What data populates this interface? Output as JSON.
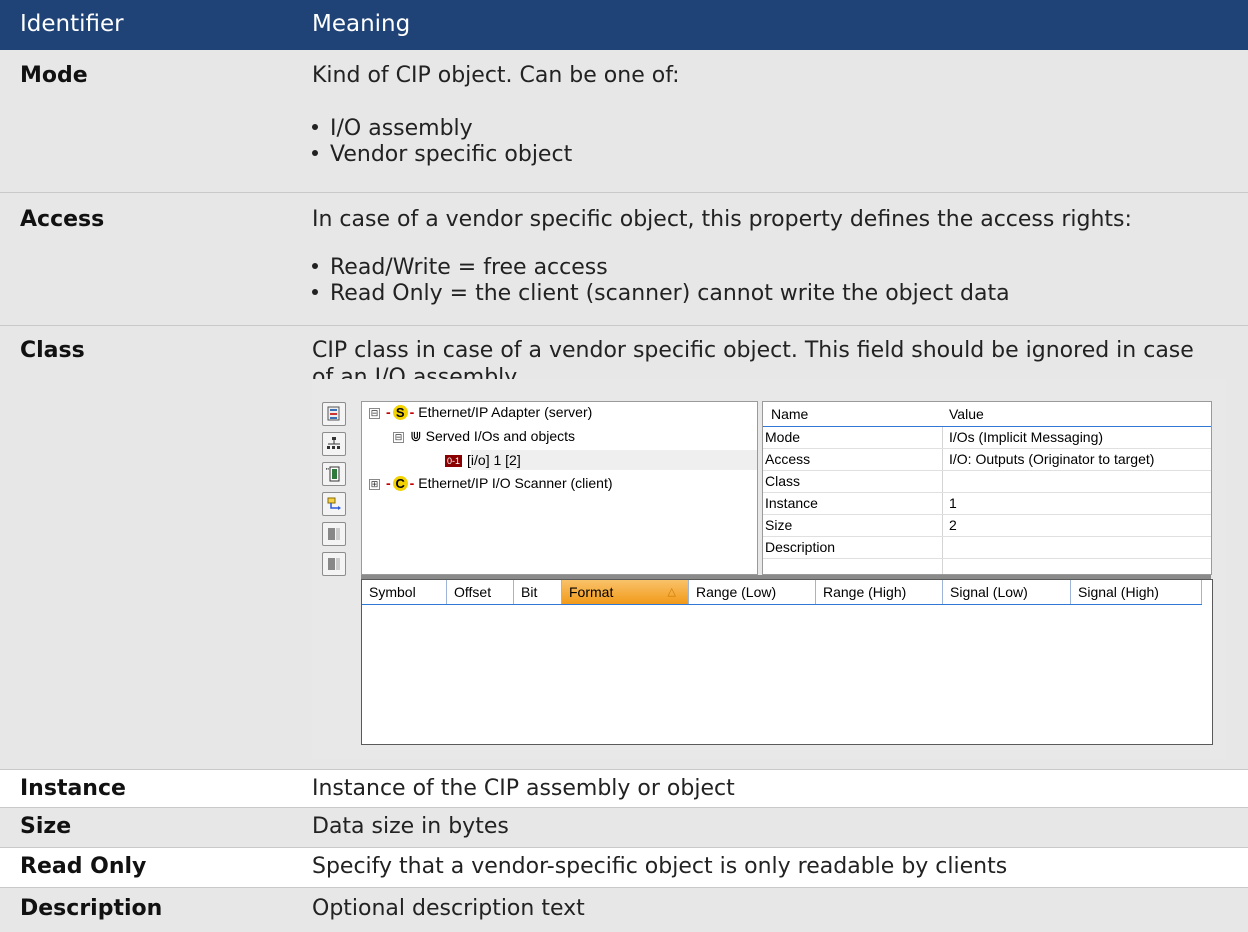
{
  "table": {
    "headers": {
      "identifier": "Identifier",
      "meaning": "Meaning"
    },
    "rows": [
      {
        "id": "Mode",
        "text": "Kind of CIP object. Can be one of:",
        "bullets": [
          "I/O assembly",
          "Vendor specific object"
        ]
      },
      {
        "id": "Access",
        "text": "In case of a vendor specific object, this property defines the access rights:",
        "bullets": [
          "Read/Write = free access",
          "Read Only = the client (scanner) cannot write the object data"
        ]
      },
      {
        "id": "Class",
        "text": "CIP class in case of a vendor specific object. This field should be ignored in case of an I/O assembly."
      },
      {
        "id": "Instance",
        "text": "Instance of the CIP assembly or object"
      },
      {
        "id": "Size",
        "text": "Data size in bytes"
      },
      {
        "id": "Read Only",
        "text": "Specify that a vendor-specific object is only readable by clients"
      },
      {
        "id": "Description",
        "text": "Optional description text"
      }
    ]
  },
  "screenshot": {
    "tree": [
      {
        "badge": "S",
        "label": "Ethernet/IP Adapter (server)",
        "toggle": "⊟"
      },
      {
        "label": "Served I/Os and objects",
        "toggle": "⊟"
      },
      {
        "icon_text": "0-1",
        "label": "[i/o] 1 [2]"
      },
      {
        "badge": "C",
        "label": "Ethernet/IP I/O Scanner (client)",
        "toggle": "⊞"
      }
    ],
    "props_headers": {
      "name": "Name",
      "value": "Value"
    },
    "props": [
      {
        "name": "Mode",
        "value": "I/Os (Implicit Messaging)"
      },
      {
        "name": "Access",
        "value": "I/O: Outputs (Originator to target)"
      },
      {
        "name": "Class",
        "value": ""
      },
      {
        "name": "Instance",
        "value": "1"
      },
      {
        "name": "Size",
        "value": "2"
      },
      {
        "name": "Description",
        "value": ""
      }
    ],
    "grid_columns": [
      "Symbol",
      "Offset",
      "Bit",
      "Format",
      "Range (Low)",
      "Range (High)",
      "Signal (Low)",
      "Signal (High)"
    ],
    "sort_glyph": "△",
    "toolbar_icons": [
      "tree-view-icon",
      "network-icon",
      "add-object-icon",
      "mapping-icon",
      "disabled-io-icon",
      "disabled-io2-icon"
    ],
    "colors": {
      "header_bg": "#1f4377",
      "active_column": "#f29a1a",
      "selection_blue": "#2f78d6"
    }
  }
}
